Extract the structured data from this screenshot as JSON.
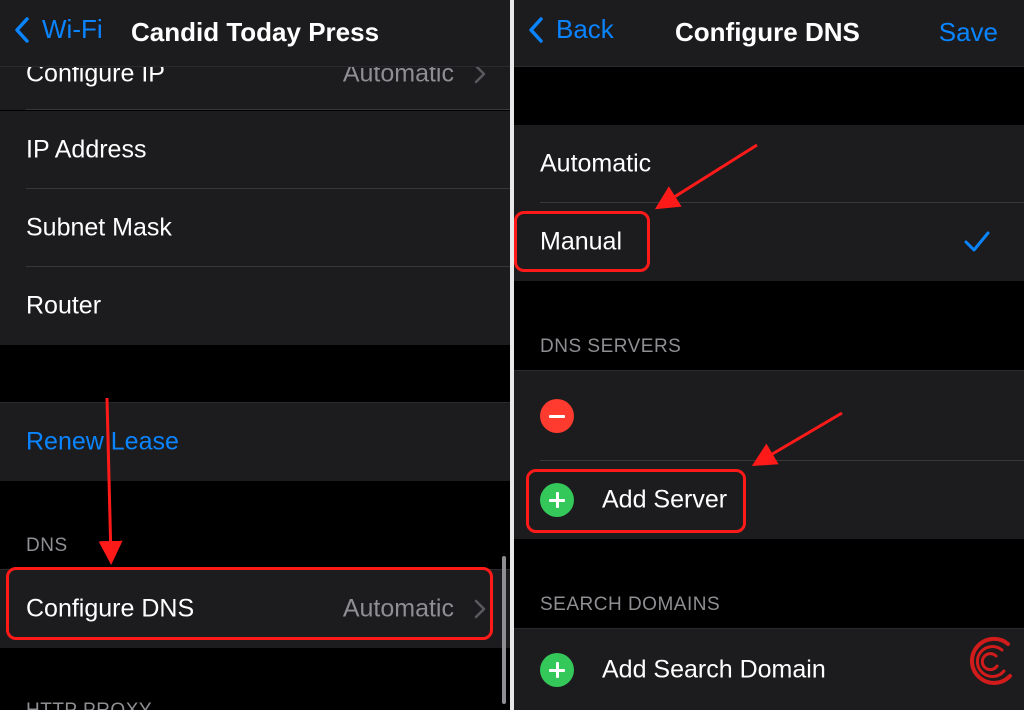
{
  "left": {
    "back_label": "Wi-Fi",
    "title": "Candid Today Press",
    "configure_ip": {
      "label": "Configure IP",
      "value": "Automatic"
    },
    "ip_address": {
      "label": "IP Address"
    },
    "subnet_mask": {
      "label": "Subnet Mask"
    },
    "router": {
      "label": "Router"
    },
    "renew_lease": "Renew Lease",
    "dns_header": "DNS",
    "configure_dns": {
      "label": "Configure DNS",
      "value": "Automatic"
    },
    "http_proxy_header": "HTTP PROXY"
  },
  "right": {
    "back_label": "Back",
    "title": "Configure DNS",
    "save_label": "Save",
    "modes": [
      {
        "label": "Automatic",
        "selected": false
      },
      {
        "label": "Manual",
        "selected": true
      }
    ],
    "dns_servers_header": "DNS SERVERS",
    "add_server": "Add Server",
    "search_domains_header": "SEARCH DOMAINS",
    "add_search_domain": "Add Search Domain"
  },
  "colors": {
    "accent": "#0a84ff",
    "highlight": "#ff1a1a",
    "delete": "#ff3b30",
    "add": "#34c759",
    "background": "#000000",
    "cell": "#1c1c1e"
  },
  "icons": [
    "chevron-left-icon",
    "chevron-right-icon",
    "checkmark-icon",
    "minus-circle-icon",
    "plus-circle-icon",
    "logo-icon"
  ]
}
